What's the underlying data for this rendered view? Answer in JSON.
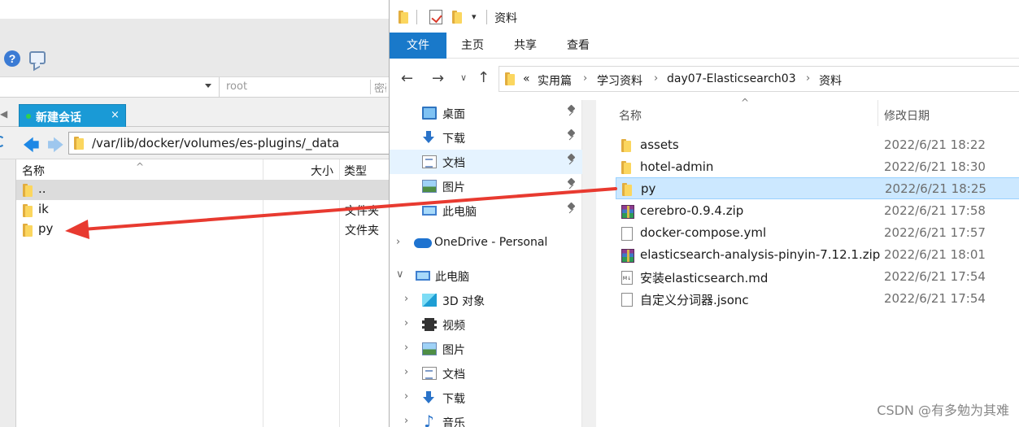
{
  "left_app": {
    "host_user_placeholder": "root",
    "host_pass_placeholder": "密码",
    "session_tab": "新建会话",
    "session_close": "×",
    "path": "/var/lib/docker/volumes/es-plugins/_data",
    "columns": {
      "name": "名称",
      "size": "大小",
      "type": "类型"
    },
    "rows": [
      {
        "name": "..",
        "type": ""
      },
      {
        "name": "ik",
        "type": "文件夹"
      },
      {
        "name": "py",
        "type": "文件夹"
      }
    ]
  },
  "explorer": {
    "title": "资料",
    "ribbon_tabs": [
      "文件",
      "主页",
      "共享",
      "查看"
    ],
    "breadcrumb": [
      "实用篇",
      "学习资料",
      "day07-Elasticsearch03",
      "资料"
    ],
    "breadcrumb_prefix": "«",
    "nav_items": [
      {
        "label": "桌面",
        "icon": "desktop-icon",
        "pinned": true
      },
      {
        "label": "下载",
        "icon": "download-icon",
        "pinned": true
      },
      {
        "label": "文档",
        "icon": "document-icon",
        "pinned": true
      },
      {
        "label": "图片",
        "icon": "picture-icon",
        "pinned": true
      },
      {
        "label": "此电脑",
        "icon": "computer-icon",
        "pinned": true
      },
      {
        "label": "OneDrive - Personal",
        "icon": "cloud-icon"
      },
      {
        "label": "此电脑",
        "icon": "computer-icon"
      },
      {
        "label": "3D 对象",
        "icon": "3d-objects-icon"
      },
      {
        "label": "视频",
        "icon": "video-icon"
      },
      {
        "label": "图片",
        "icon": "picture-icon"
      },
      {
        "label": "文档",
        "icon": "document-icon"
      },
      {
        "label": "下载",
        "icon": "download-icon"
      },
      {
        "label": "音乐",
        "icon": "music-icon"
      }
    ],
    "columns": {
      "name": "名称",
      "modified": "修改日期"
    },
    "files": [
      {
        "name": "assets",
        "date": "2022/6/21 18:22",
        "icon": "folder-icon"
      },
      {
        "name": "hotel-admin",
        "date": "2022/6/21 18:30",
        "icon": "folder-icon"
      },
      {
        "name": "py",
        "date": "2022/6/21 18:25",
        "icon": "folder-icon"
      },
      {
        "name": "cerebro-0.9.4.zip",
        "date": "2022/6/21 17:58",
        "icon": "zip-icon"
      },
      {
        "name": "docker-compose.yml",
        "date": "2022/6/21 17:57",
        "icon": "file-icon"
      },
      {
        "name": "elasticsearch-analysis-pinyin-7.12.1.zip",
        "date": "2022/6/21 18:01",
        "icon": "zip-icon"
      },
      {
        "name": "安装elasticsearch.md",
        "date": "2022/6/21 17:54",
        "icon": "markdown-icon"
      },
      {
        "name": "自定义分词器.jsonc",
        "date": "2022/6/21 17:54",
        "icon": "file-icon"
      }
    ]
  },
  "watermark": "CSDN @有多勉为其难",
  "colors": {
    "accent": "#1979ca",
    "session_tab": "#1a9ad6",
    "selection": "#cce8ff",
    "arrow": "#e83a30"
  }
}
